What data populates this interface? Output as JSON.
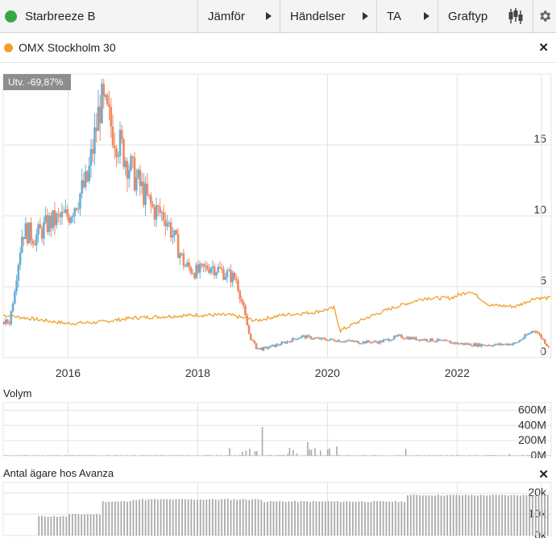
{
  "toolbar": {
    "stock_name": "Starbreeze B",
    "stock_color": "#3aa64a",
    "menus": [
      "Jämför",
      "Händelser",
      "TA",
      "Graftyp"
    ],
    "graph_type_icon": "candlestick-icon",
    "settings_icon": "gear-icon"
  },
  "compare": {
    "label": "OMX Stockholm 30",
    "color": "#f0a02a",
    "close_icon": "close-icon"
  },
  "badge": "Utv. -69,87%",
  "volume": {
    "title": "Volym"
  },
  "owners": {
    "title": "Antal ägare hos Avanza"
  },
  "colors": {
    "up": "#6aaed6",
    "down": "#f08a60",
    "index_line": "#f0a02a",
    "bars": "#aaaaaa"
  },
  "chart_data": [
    {
      "type": "candlestick",
      "title": "Starbreeze B",
      "x_ticks": [
        "2016",
        "2018",
        "2020",
        "2022"
      ],
      "y_ticks": [
        0,
        5,
        10,
        15
      ],
      "ylim": [
        0,
        20
      ],
      "series": [
        {
          "name": "Starbreeze B",
          "x": [
            2015.1,
            2015.3,
            2015.5,
            2015.7,
            2016.0,
            2016.3,
            2016.5,
            2016.8,
            2017.0,
            2017.3,
            2017.5,
            2017.8,
            2018.0,
            2018.2,
            2018.4,
            2018.6,
            2018.8,
            2018.9,
            2019.0,
            2019.3,
            2019.6,
            2019.9,
            2020.2,
            2020.5,
            2020.8,
            2021.1,
            2021.4,
            2021.7,
            2022.0,
            2022.3,
            2022.6,
            2022.9,
            2023.2,
            2023.4
          ],
          "values": [
            2.5,
            9.0,
            8.5,
            9.5,
            10.0,
            12.5,
            18.0,
            15.0,
            13.0,
            10.5,
            10.0,
            6.5,
            6.0,
            6.5,
            6.0,
            5.5,
            1.5,
            0.7,
            0.6,
            1.0,
            1.5,
            1.3,
            1.2,
            1.1,
            1.1,
            1.5,
            1.3,
            1.2,
            1.0,
            0.9,
            0.9,
            1.0,
            2.0,
            0.8
          ]
        },
        {
          "name": "OMX Stockholm 30",
          "x": [
            2015.0,
            2015.5,
            2016.0,
            2016.5,
            2017.0,
            2017.5,
            2018.0,
            2018.5,
            2018.9,
            2019.3,
            2019.8,
            2020.1,
            2020.2,
            2020.6,
            2021.0,
            2021.5,
            2021.9,
            2022.2,
            2022.5,
            2022.9,
            2023.2,
            2023.45
          ],
          "values": [
            3.0,
            2.7,
            2.4,
            2.5,
            2.8,
            2.9,
            3.0,
            3.0,
            2.6,
            3.0,
            3.2,
            3.5,
            1.9,
            2.8,
            3.5,
            4.2,
            4.2,
            4.7,
            3.7,
            3.6,
            4.2,
            4.2
          ]
        }
      ]
    },
    {
      "type": "bar",
      "title": "Volym",
      "y_ticks": [
        "600M",
        "400M",
        "200M",
        "0M"
      ],
      "ylim": [
        0,
        700
      ],
      "series": [
        {
          "name": "Volym",
          "x": [
            2018.5,
            2018.9,
            2019.0,
            2019.7,
            2019.8,
            2019.9,
            2021.2,
            2022.8,
            2023.3
          ],
          "values": [
            100,
            60,
            380,
            180,
            100,
            70,
            90,
            25,
            40
          ]
        }
      ]
    },
    {
      "type": "bar",
      "title": "Antal ägare hos Avanza",
      "y_ticks": [
        "20k",
        "10k",
        "0k"
      ],
      "ylim": [
        0,
        25
      ],
      "series": [
        {
          "name": "Antal ägare hos Avanza",
          "x": [
            2015.5,
            2016.0,
            2016.5,
            2017.0,
            2018.0,
            2019.0,
            2020.0,
            2021.0,
            2021.2,
            2022.0,
            2023.0,
            2023.4
          ],
          "values": [
            9,
            10,
            16,
            17,
            17,
            16,
            16,
            16,
            19,
            19,
            19,
            20
          ]
        }
      ]
    }
  ]
}
